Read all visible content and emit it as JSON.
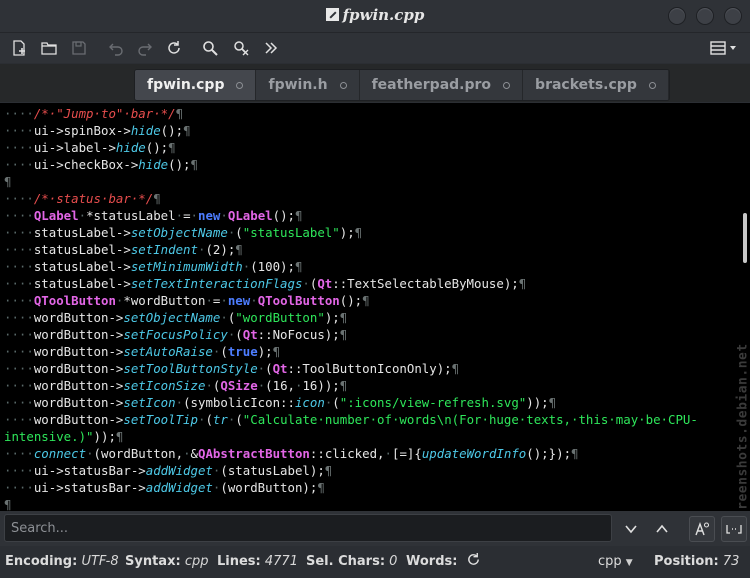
{
  "window": {
    "title": "fpwin.cpp",
    "buttons": [
      "minimize",
      "maximize",
      "close"
    ]
  },
  "toolbar": {
    "icons": [
      "new-document-icon",
      "open-folder-icon",
      "save-icon",
      "undo-icon",
      "redo-icon",
      "reload-icon",
      "find-icon",
      "replace-icon",
      "jump-icon",
      "menu-icon"
    ]
  },
  "tabs": [
    {
      "label": "fpwin.cpp",
      "active": true
    },
    {
      "label": "fpwin.h",
      "active": false
    },
    {
      "label": "featherpad.pro",
      "active": false
    },
    {
      "label": "brackets.cpp",
      "active": false
    }
  ],
  "editor": {
    "lines": [
      [
        [
          "ws",
          "····"
        ],
        [
          "cm",
          "/*·\"Jump·to\"·bar·*/"
        ],
        [
          "pl",
          "¶"
        ]
      ],
      [
        [
          "ws",
          "····"
        ],
        [
          "tx",
          "ui->spinBox->"
        ],
        [
          "fn",
          "hide"
        ],
        [
          "tx",
          "();"
        ],
        [
          "pl",
          "¶"
        ]
      ],
      [
        [
          "ws",
          "····"
        ],
        [
          "tx",
          "ui->label->"
        ],
        [
          "fn",
          "hide"
        ],
        [
          "tx",
          "();"
        ],
        [
          "pl",
          "¶"
        ]
      ],
      [
        [
          "ws",
          "····"
        ],
        [
          "tx",
          "ui->checkBox->"
        ],
        [
          "fn",
          "hide"
        ],
        [
          "tx",
          "();"
        ],
        [
          "pl",
          "¶"
        ]
      ],
      [
        [
          "pl",
          "¶"
        ]
      ],
      [
        [
          "ws",
          "····"
        ],
        [
          "cm",
          "/*·status·bar·*/"
        ],
        [
          "pl",
          "¶"
        ]
      ],
      [
        [
          "ws",
          "····"
        ],
        [
          "ty",
          "QLabel"
        ],
        [
          "ws",
          "·"
        ],
        [
          "tx",
          "*statusLabel"
        ],
        [
          "ws",
          "·"
        ],
        [
          "tx",
          "="
        ],
        [
          "ws",
          "·"
        ],
        [
          "kw",
          "new"
        ],
        [
          "ws",
          "·"
        ],
        [
          "ty",
          "QLabel"
        ],
        [
          "tx",
          "();"
        ],
        [
          "pl",
          "¶"
        ]
      ],
      [
        [
          "ws",
          "····"
        ],
        [
          "tx",
          "statusLabel->"
        ],
        [
          "fn",
          "setObjectName"
        ],
        [
          "ws",
          "·"
        ],
        [
          "tx",
          "("
        ],
        [
          "st",
          "\"statusLabel\""
        ],
        [
          "tx",
          ");"
        ],
        [
          "pl",
          "¶"
        ]
      ],
      [
        [
          "ws",
          "····"
        ],
        [
          "tx",
          "statusLabel->"
        ],
        [
          "fn",
          "setIndent"
        ],
        [
          "ws",
          "·"
        ],
        [
          "tx",
          "(2);"
        ],
        [
          "pl",
          "¶"
        ]
      ],
      [
        [
          "ws",
          "····"
        ],
        [
          "tx",
          "statusLabel->"
        ],
        [
          "fn",
          "setMinimumWidth"
        ],
        [
          "ws",
          "·"
        ],
        [
          "tx",
          "(100);"
        ],
        [
          "pl",
          "¶"
        ]
      ],
      [
        [
          "ws",
          "····"
        ],
        [
          "tx",
          "statusLabel->"
        ],
        [
          "fn",
          "setTextInteractionFlags"
        ],
        [
          "ws",
          "·"
        ],
        [
          "tx",
          "("
        ],
        [
          "ty",
          "Qt"
        ],
        [
          "tx",
          "::TextSelectableByMouse);"
        ],
        [
          "pl",
          "¶"
        ]
      ],
      [
        [
          "ws",
          "····"
        ],
        [
          "ty",
          "QToolButton"
        ],
        [
          "ws",
          "·"
        ],
        [
          "tx",
          "*wordButton"
        ],
        [
          "ws",
          "·"
        ],
        [
          "tx",
          "="
        ],
        [
          "ws",
          "·"
        ],
        [
          "kw",
          "new"
        ],
        [
          "ws",
          "·"
        ],
        [
          "ty",
          "QToolButton"
        ],
        [
          "tx",
          "();"
        ],
        [
          "pl",
          "¶"
        ]
      ],
      [
        [
          "ws",
          "····"
        ],
        [
          "tx",
          "wordButton->"
        ],
        [
          "fn",
          "setObjectName"
        ],
        [
          "ws",
          "·"
        ],
        [
          "tx",
          "("
        ],
        [
          "st",
          "\"wordButton\""
        ],
        [
          "tx",
          ");"
        ],
        [
          "pl",
          "¶"
        ]
      ],
      [
        [
          "ws",
          "····"
        ],
        [
          "tx",
          "wordButton->"
        ],
        [
          "fn",
          "setFocusPolicy"
        ],
        [
          "ws",
          "·"
        ],
        [
          "tx",
          "("
        ],
        [
          "ty",
          "Qt"
        ],
        [
          "tx",
          "::NoFocus);"
        ],
        [
          "pl",
          "¶"
        ]
      ],
      [
        [
          "ws",
          "····"
        ],
        [
          "tx",
          "wordButton->"
        ],
        [
          "fn",
          "setAutoRaise"
        ],
        [
          "ws",
          "·"
        ],
        [
          "tx",
          "("
        ],
        [
          "kw",
          "true"
        ],
        [
          "tx",
          ");"
        ],
        [
          "pl",
          "¶"
        ]
      ],
      [
        [
          "ws",
          "····"
        ],
        [
          "tx",
          "wordButton->"
        ],
        [
          "fn",
          "setToolButtonStyle"
        ],
        [
          "ws",
          "·"
        ],
        [
          "tx",
          "("
        ],
        [
          "ty",
          "Qt"
        ],
        [
          "tx",
          "::ToolButtonIconOnly);"
        ],
        [
          "pl",
          "¶"
        ]
      ],
      [
        [
          "ws",
          "····"
        ],
        [
          "tx",
          "wordButton->"
        ],
        [
          "fn",
          "setIconSize"
        ],
        [
          "ws",
          "·"
        ],
        [
          "tx",
          "("
        ],
        [
          "ty",
          "QSize"
        ],
        [
          "ws",
          "·"
        ],
        [
          "tx",
          "(16,"
        ],
        [
          "ws",
          "·"
        ],
        [
          "tx",
          "16));"
        ],
        [
          "pl",
          "¶"
        ]
      ],
      [
        [
          "ws",
          "····"
        ],
        [
          "tx",
          "wordButton->"
        ],
        [
          "fn",
          "setIcon"
        ],
        [
          "ws",
          "·"
        ],
        [
          "tx",
          "(symbolicIcon::"
        ],
        [
          "fn",
          "icon"
        ],
        [
          "ws",
          "·"
        ],
        [
          "tx",
          "("
        ],
        [
          "st",
          "\":icons/view-refresh.svg\""
        ],
        [
          "tx",
          "));"
        ],
        [
          "pl",
          "¶"
        ]
      ],
      [
        [
          "ws",
          "····"
        ],
        [
          "tx",
          "wordButton->"
        ],
        [
          "fn",
          "setToolTip"
        ],
        [
          "ws",
          "·"
        ],
        [
          "tx",
          "("
        ],
        [
          "fn",
          "tr"
        ],
        [
          "ws",
          "·"
        ],
        [
          "tx",
          "("
        ],
        [
          "st",
          "\"Calculate·number·of·words\\n(For·huge·texts,·this·may·be·CPU-"
        ]
      ],
      [
        [
          "st",
          "intensive.)\""
        ],
        [
          "tx",
          "));"
        ],
        [
          "pl",
          "¶"
        ]
      ],
      [
        [
          "ws",
          "····"
        ],
        [
          "fn",
          "connect"
        ],
        [
          "ws",
          "·"
        ],
        [
          "tx",
          "(wordButton,"
        ],
        [
          "ws",
          "·"
        ],
        [
          "tx",
          "&"
        ],
        [
          "ty",
          "QAbstractButton"
        ],
        [
          "tx",
          "::clicked,"
        ],
        [
          "ws",
          "·"
        ],
        [
          "tx",
          "[=]{"
        ],
        [
          "fn",
          "updateWordInfo"
        ],
        [
          "tx",
          "();});"
        ],
        [
          "pl",
          "¶"
        ]
      ],
      [
        [
          "ws",
          "····"
        ],
        [
          "tx",
          "ui->statusBar->"
        ],
        [
          "fn",
          "addWidget"
        ],
        [
          "ws",
          "·"
        ],
        [
          "tx",
          "(statusLabel);"
        ],
        [
          "pl",
          "¶"
        ]
      ],
      [
        [
          "ws",
          "····"
        ],
        [
          "tx",
          "ui->statusBar->"
        ],
        [
          "fn",
          "addWidget"
        ],
        [
          "ws",
          "·"
        ],
        [
          "tx",
          "(wordButton);"
        ],
        [
          "pl",
          "¶"
        ]
      ],
      [
        [
          "pl",
          "¶"
        ]
      ]
    ]
  },
  "watermark": "screenshots.debian.net",
  "search": {
    "placeholder": "Search...",
    "value": ""
  },
  "statusbar": {
    "encoding_label": "Encoding:",
    "encoding_value": "UTF-8",
    "syntax_label": "Syntax:",
    "syntax_value": "cpp",
    "lines_label": "Lines:",
    "lines_value": "4771",
    "sel_label": "Sel. Chars:",
    "sel_value": "0",
    "words_label": "Words:",
    "lang_value": "cpp",
    "position_label": "Position:",
    "position_value": "73"
  }
}
